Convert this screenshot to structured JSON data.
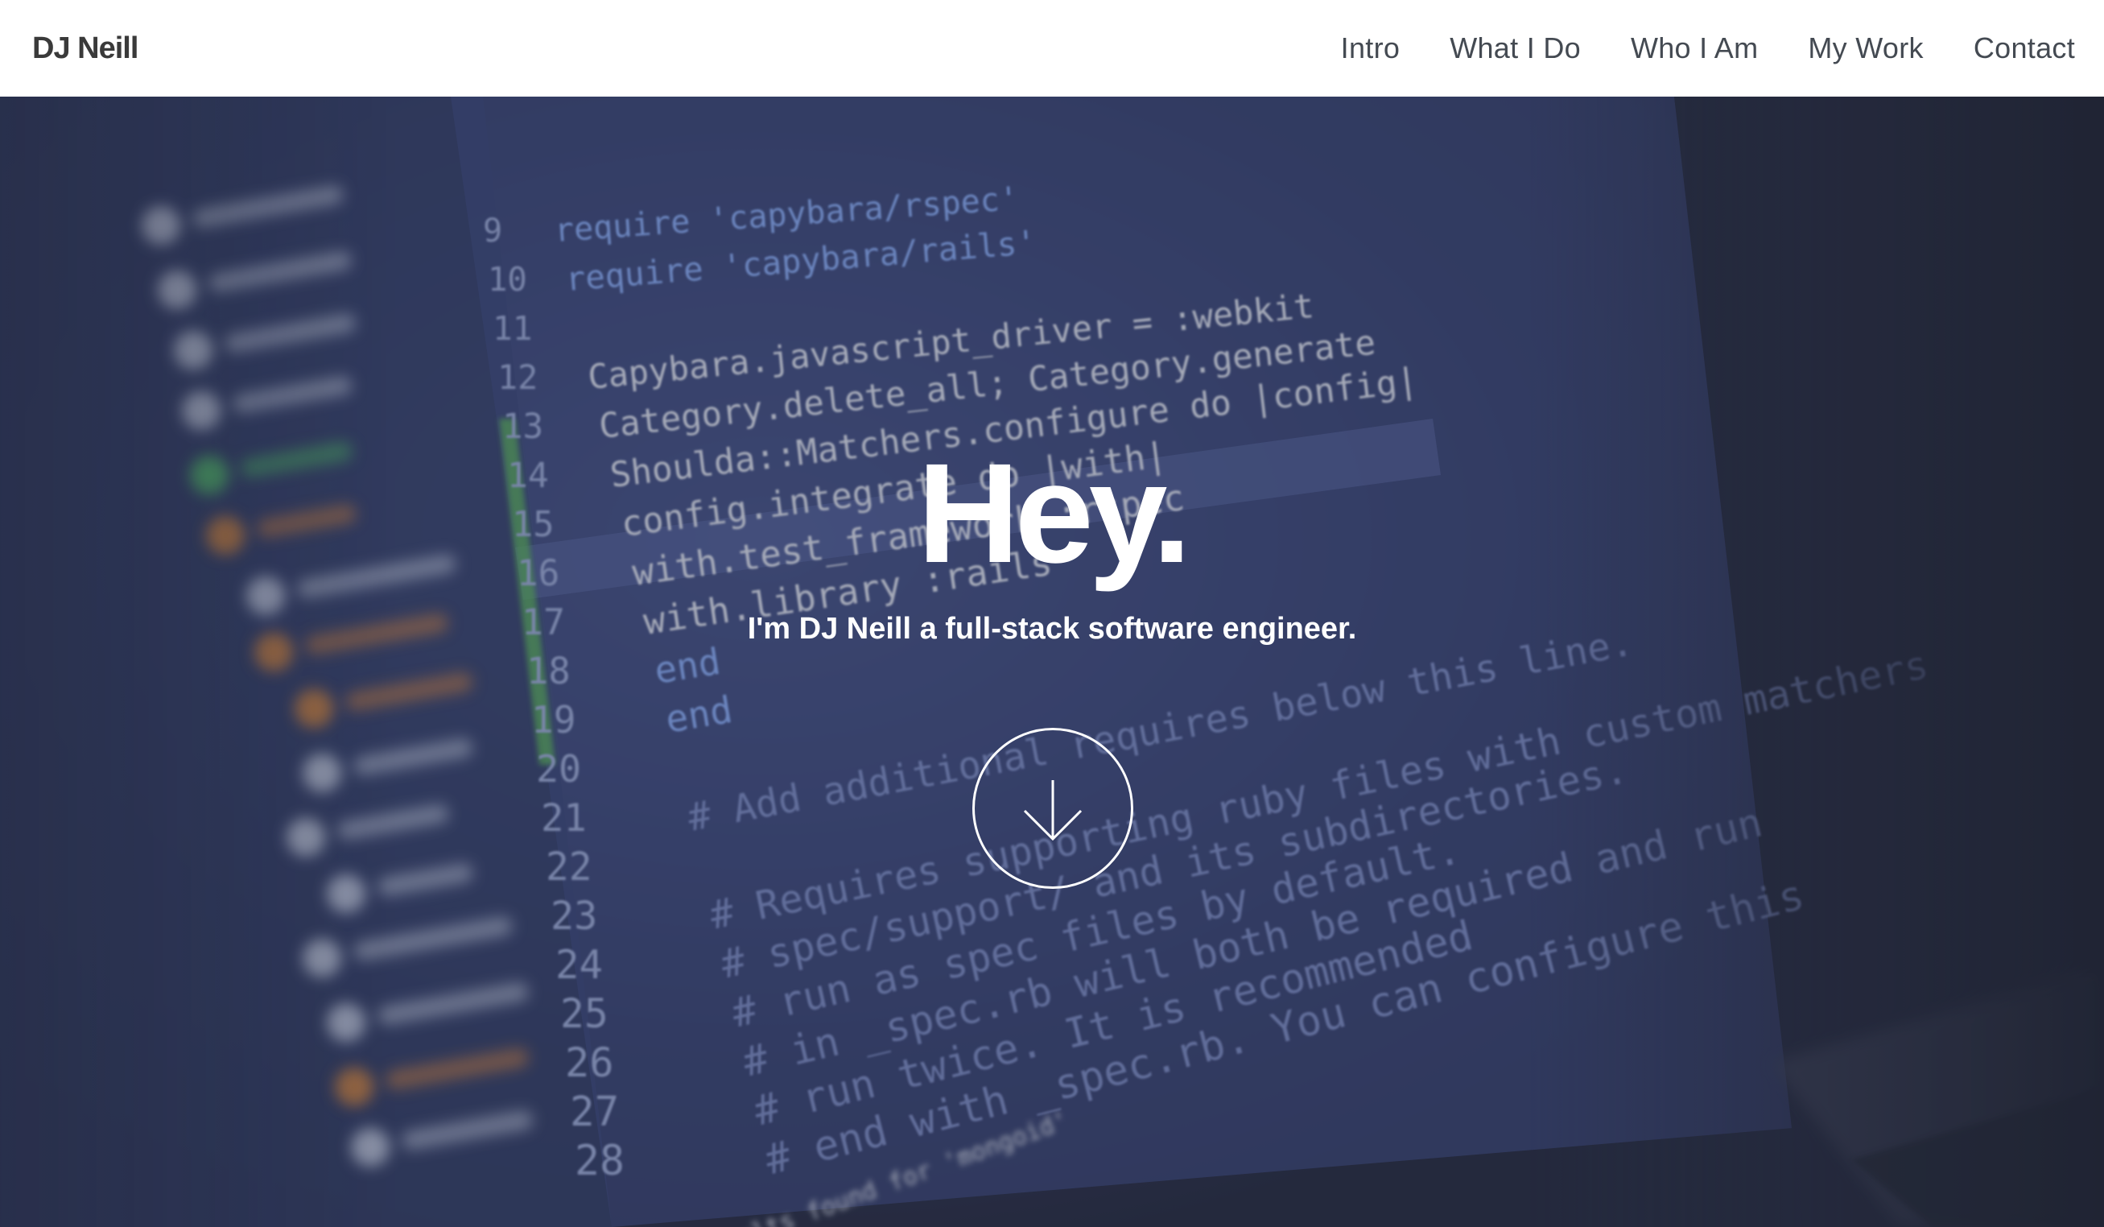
{
  "header": {
    "brand": "DJ Neill",
    "nav": [
      {
        "label": "Intro"
      },
      {
        "label": "What I Do"
      },
      {
        "label": "Who I Am"
      },
      {
        "label": "My Work"
      },
      {
        "label": "Contact"
      }
    ]
  },
  "hero": {
    "title": "Hey.",
    "subtitle": "I'm DJ Neill a full-stack software engineer.",
    "scroll_icon": "arrow-down-icon",
    "background": {
      "code_lines": [
        {
          "num": "9",
          "text": "require 'capybara/rspec'"
        },
        {
          "num": "10",
          "text": "require 'capybara/rails'"
        },
        {
          "num": "11",
          "text": ""
        },
        {
          "num": "12",
          "text": "Capybara.javascript_driver = :webkit"
        },
        {
          "num": "13",
          "text": "Category.delete_all; Category.generate"
        },
        {
          "num": "14",
          "text": "Shoulda::Matchers.configure do |config|"
        },
        {
          "num": "15",
          "text": "  config.integrate do |with|"
        },
        {
          "num": "16",
          "text": "    with.test_framework :rspec"
        },
        {
          "num": "17",
          "text": "    with.library :rails"
        },
        {
          "num": "18",
          "text": "  end"
        },
        {
          "num": "19",
          "text": "end"
        },
        {
          "num": "20",
          "text": ""
        },
        {
          "num": "21",
          "text": "# Add additional requires below this line."
        },
        {
          "num": "22",
          "text": ""
        },
        {
          "num": "23",
          "text": "# Requires supporting ruby files with custom matchers"
        },
        {
          "num": "24",
          "text": "# spec/support/ and its subdirectories."
        },
        {
          "num": "25",
          "text": "# run as spec files by default."
        },
        {
          "num": "26",
          "text": "# in _spec.rb will both be required and run"
        },
        {
          "num": "27",
          "text": "# run twice. It is recommended"
        },
        {
          "num": "28",
          "text": "# end with _spec.rb. You can configure this"
        }
      ],
      "status_text": "No results found for 'mongoid'",
      "colors": {
        "keyword": "#8fb4ff",
        "string": "#9fe07a",
        "plain": "#e8ecf6",
        "comment": "#8d9ed8",
        "line_number": "#a4b3de",
        "tree_orange": "#f0923a",
        "tree_green": "#58d46a",
        "tree_white": "#dfe6f6"
      }
    }
  }
}
